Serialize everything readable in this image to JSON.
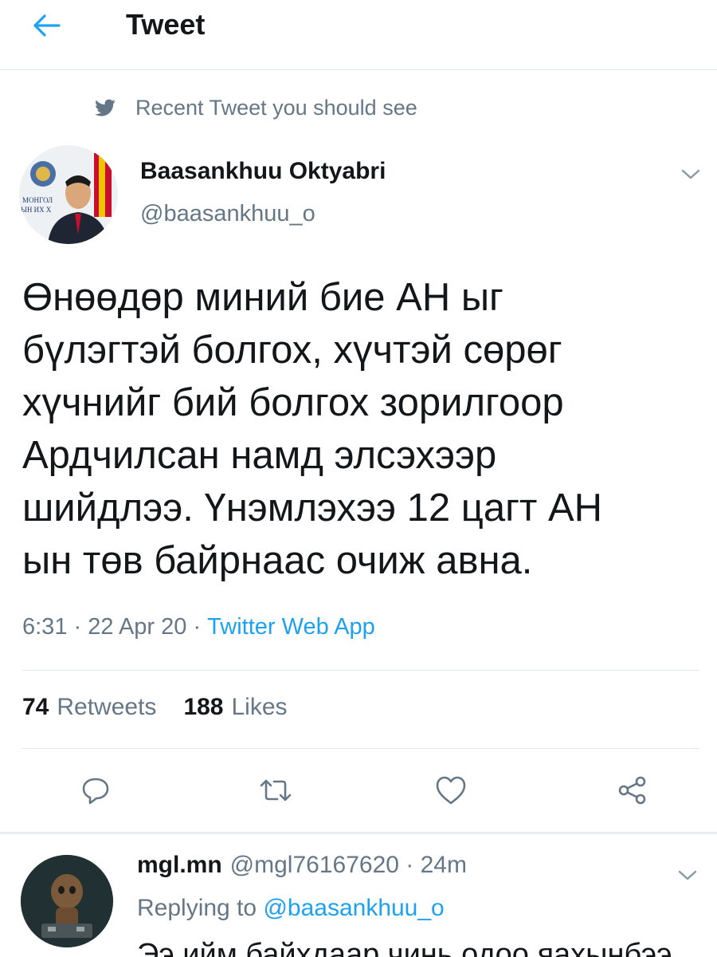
{
  "header": {
    "title": "Tweet",
    "back_icon": "back-arrow-icon"
  },
  "recent_label": {
    "icon": "twitter-bird-icon",
    "text": "Recent Tweet you should see"
  },
  "tweet": {
    "author_name": "Baasankhuu Oktyabri",
    "author_handle": "@baasankhuu_o",
    "avatar_text": [
      "МОНГОЛ",
      "ЫН ИХ Х"
    ],
    "text": "Өнөөдөр миний бие АН ыг\nбүлэгтэй болгох, хүчтэй сөрөг\nхүчнийг бий болгох зорилгоор\nАрдчилсан намд элсэхээр\nшийдлээ. Үнэмлэхээ 12 цагт АН\nын төв байрнаас очиж авна.",
    "time": "6:31",
    "date": "22 Apr 20",
    "source": "Twitter Web App",
    "retweets_count": "74",
    "retweets_label": "Retweets",
    "likes_count": "188",
    "likes_label": "Likes"
  },
  "actions": [
    {
      "name": "reply",
      "icon": "reply-icon"
    },
    {
      "name": "retweet",
      "icon": "retweet-icon"
    },
    {
      "name": "like",
      "icon": "heart-icon"
    },
    {
      "name": "share",
      "icon": "share-icon"
    }
  ],
  "reply": {
    "author_name": "mgl.mn",
    "author_handle": "@mgl76167620",
    "time": "24m",
    "replying_prefix": "Replying to",
    "replying_to": "@baasankhuu_o",
    "text": "Ээ ийм байхдаар чинь одоо яахынбээ"
  },
  "colors": {
    "accent": "#1da1f2",
    "secondary_text": "#657786",
    "primary_text": "#14171a",
    "divider": "#e1e8ed"
  }
}
